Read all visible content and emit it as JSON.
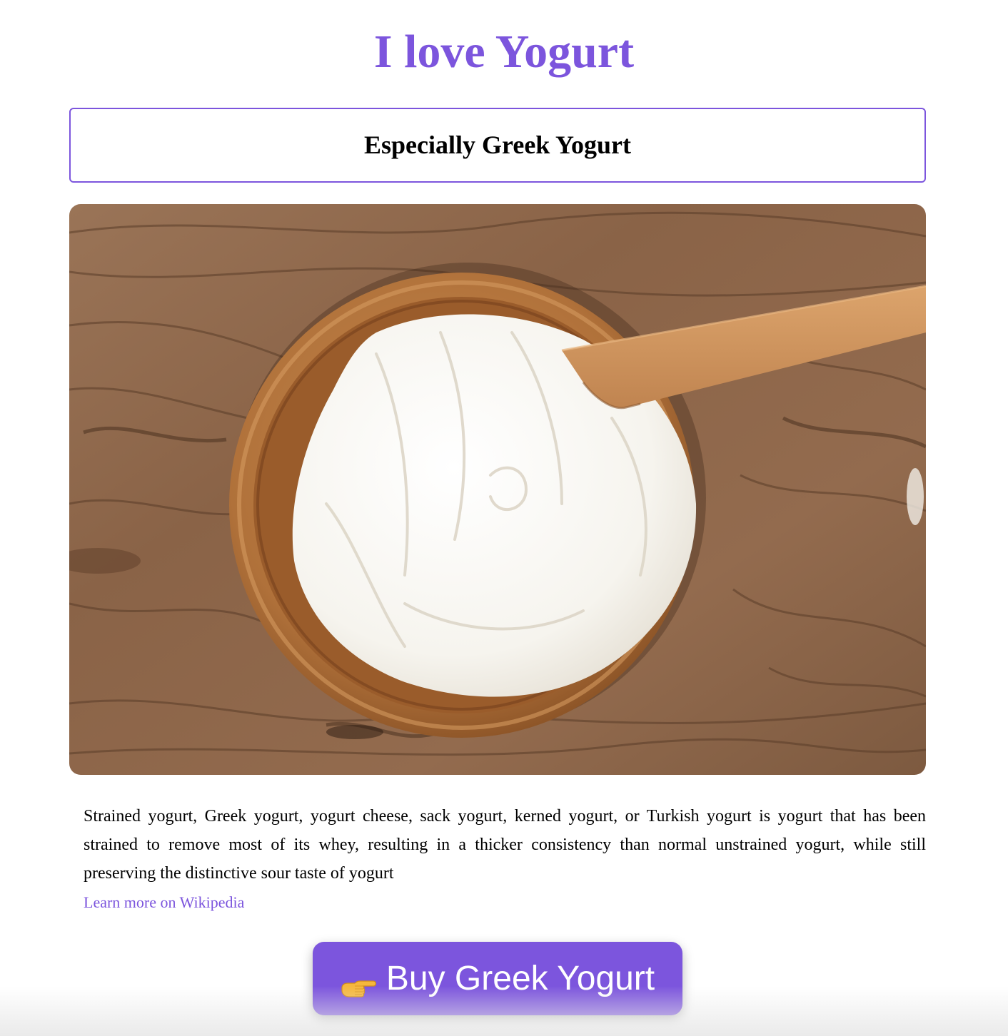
{
  "page": {
    "title": "I love Yogurt",
    "subtitle": "Especially Greek Yogurt",
    "hero_image_alt": "Bowl of Greek yogurt with a wooden spoon",
    "description": "Strained yogurt, Greek yogurt, yogurt cheese, sack yogurt, kerned yogurt, or Turkish yogurt is yogurt that has been strained to remove most of its whey, resulting in a thicker consistency than normal unstrained yogurt, while still preserving the distinctive sour taste of yogurt",
    "learn_more_link": "Learn more on Wikipedia",
    "buy_button_label": "Buy Greek Yogurt",
    "buy_button_icon": "pointing-right-hand-icon"
  },
  "colors": {
    "accent": "#7c55dd",
    "text": "#000000",
    "background": "#ffffff",
    "button_text": "#ffffff"
  }
}
